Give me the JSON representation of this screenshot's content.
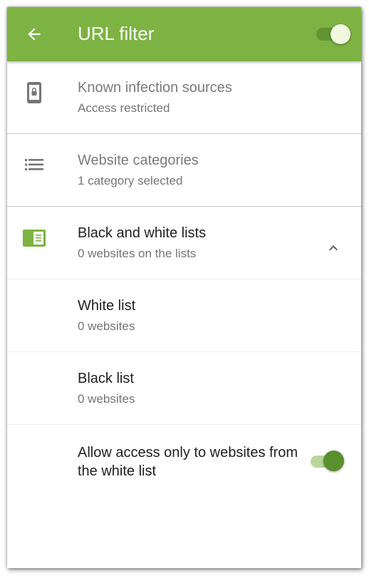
{
  "appbar": {
    "title": "URL filter",
    "back_icon": "arrow-left-icon",
    "master_switch_on": true,
    "color": "#7cb342"
  },
  "items": [
    {
      "title": "Known infection sources",
      "subtitle": "Access restricted",
      "icon": "phone-lock-icon",
      "enabled": false
    },
    {
      "title": "Website categories",
      "subtitle": "1 category selected",
      "icon": "list-icon",
      "enabled": false
    },
    {
      "title": "Black and white lists",
      "subtitle": "0 websites on the lists",
      "icon": "lists-card-icon",
      "expanded": true,
      "expand_icon": "chevron-up-icon"
    }
  ],
  "sublists": [
    {
      "title": "White list",
      "subtitle": "0 websites"
    },
    {
      "title": "Black list",
      "subtitle": "0 websites"
    }
  ],
  "allow_only_white": {
    "label": "Allow access only to websites from the white list",
    "on": true
  },
  "colors": {
    "accent": "#7cb342",
    "switch_on": "#5a8f2e",
    "text_primary": "#212121",
    "text_secondary": "#757575"
  }
}
